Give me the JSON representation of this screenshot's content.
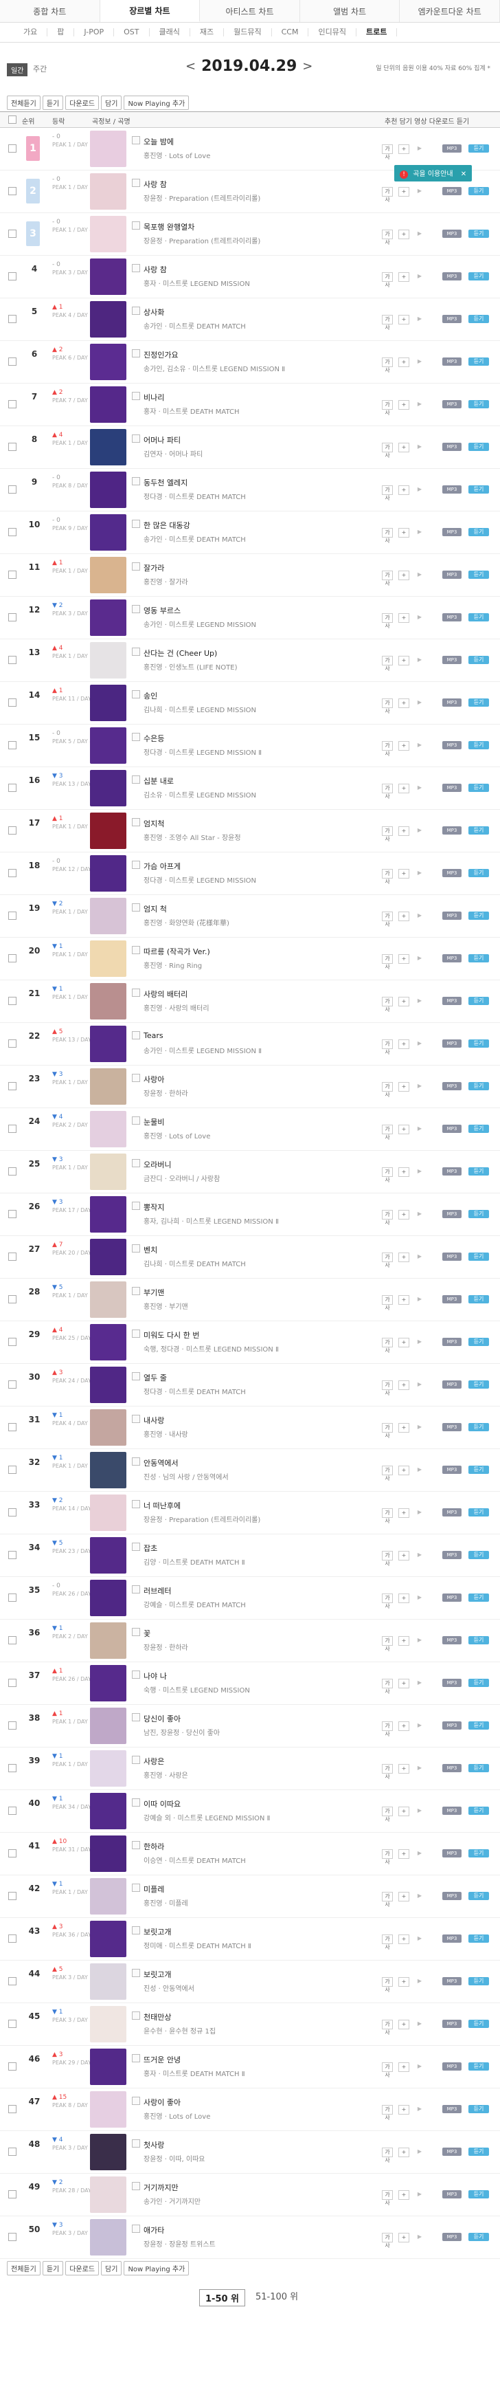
{
  "main_tabs": [
    "종합 차트",
    "장르별 차트",
    "아티스트 차트",
    "앨범 차트",
    "엠카운트다운 차트"
  ],
  "active_main_tab": 1,
  "sub_tabs": [
    "가요",
    "팝",
    "J-POP",
    "OST",
    "클래식",
    "재즈",
    "월드뮤직",
    "CCM",
    "인디뮤직",
    "트로트"
  ],
  "active_sub_tab": 9,
  "period": {
    "mode_badge": "일간",
    "mode_text": "주간",
    "date": "2019.04.29",
    "prev": "<",
    "next": ">",
    "note": "일 단위의 음원 이용 40% 자료 60% 집계 *"
  },
  "toolbar": [
    "전체듣기",
    "듣기",
    "다운로드",
    "담기",
    "Now Playing 추가"
  ],
  "header": {
    "rank": "순위",
    "change": "등락",
    "info": "곡정보 / 곡명",
    "cols": "추천 담기 영상 다운로드 듣기"
  },
  "tooltip": {
    "warn": "!",
    "text": "곡을 이용안내",
    "close": "✕"
  },
  "rows": [
    {
      "rank": "1",
      "chg": "- 0",
      "peak": "PEAK 1 / DAY 12",
      "title": "오늘 밤에",
      "artist": "홍진영 · Lots of Love",
      "cover": "#e8cde0",
      "dir": "same",
      "box": "first"
    },
    {
      "rank": "2",
      "chg": "- 0",
      "peak": "PEAK 1 / DAY 26",
      "title": "사랑 참",
      "artist": "장윤정 · Preparation (트레트라이리롤)",
      "cover": "#ead0d6",
      "dir": "same",
      "box": "blue"
    },
    {
      "rank": "3",
      "chg": "- 0",
      "peak": "PEAK 1 / DAY 46",
      "title": "목포행 완행열차",
      "artist": "장윤정 · Preparation (트레트라이리롤)",
      "cover": "#efd7df",
      "dir": "same",
      "box": "blue"
    },
    {
      "rank": "4",
      "chg": "- 0",
      "peak": "PEAK 3 / DAY 11",
      "title": "사랑 참",
      "artist": "홍자 · 미스트롯 LEGEND MISSION",
      "cover": "#5a2a8a",
      "dir": "same"
    },
    {
      "rank": "5",
      "chg": "▲ 1",
      "peak": "PEAK 4 / DAY 31",
      "title": "상사화",
      "artist": "송가인 · 미스트롯 DEATH MATCH",
      "cover": "#4e2680",
      "dir": "up"
    },
    {
      "rank": "6",
      "chg": "▲ 2",
      "peak": "PEAK 6 / DAY 3",
      "title": "진정인가요",
      "artist": "송가인, 김소유 · 미스트롯 LEGEND MISSION Ⅱ",
      "cover": "#5b2c91",
      "dir": "up"
    },
    {
      "rank": "7",
      "chg": "▲ 2",
      "peak": "PEAK 7 / DAY 31",
      "title": "비나리",
      "artist": "홍자 · 미스트롯 DEATH MATCH",
      "cover": "#55288a",
      "dir": "up"
    },
    {
      "rank": "8",
      "chg": "▲ 4",
      "peak": "PEAK 1 / DAY 802",
      "title": "어머나 파티",
      "artist": "김연자 · 어머나 파티",
      "cover": "#2a3f7a",
      "dir": "up"
    },
    {
      "rank": "9",
      "chg": "- 0",
      "peak": "PEAK 8 / DAY 31",
      "title": "동두천 엘레지",
      "artist": "정다경 · 미스트롯 DEATH MATCH",
      "cover": "#4f2585",
      "dir": "same"
    },
    {
      "rank": "10",
      "chg": "- 0",
      "peak": "PEAK 9 / DAY 20",
      "title": "한 많은 대동강",
      "artist": "송가인 · 미스트롯 DEATH MATCH",
      "cover": "#532a8c",
      "dir": "same"
    },
    {
      "rank": "11",
      "chg": "▲ 1",
      "peak": "PEAK 1 / DAY 443",
      "title": "잘가라",
      "artist": "홍진영 · 잘가라",
      "cover": "#d9b48f",
      "dir": "up"
    },
    {
      "rank": "12",
      "chg": "▼ 2",
      "peak": "PEAK 3 / DAY 6",
      "title": "영동 부르스",
      "artist": "송가인 · 미스트롯 LEGEND MISSION",
      "cover": "#5a2b8e",
      "dir": "down"
    },
    {
      "rank": "13",
      "chg": "▲ 4",
      "peak": "PEAK 1 / DAY 1026",
      "title": "산다는 건 (Cheer Up)",
      "artist": "홍진영 · 인생노트 (LIFE NOTE)",
      "cover": "#e6e3e5",
      "dir": "up"
    },
    {
      "rank": "14",
      "chg": "▲ 1",
      "peak": "PEAK 11 / DAY 11",
      "title": "송인",
      "artist": "김나희 · 미스트롯 LEGEND MISSION",
      "cover": "#4b2682",
      "dir": "up"
    },
    {
      "rank": "15",
      "chg": "- 0",
      "peak": "PEAK 5 / DAY 4",
      "title": "수은등",
      "artist": "정다경 · 미스트롯 LEGEND MISSION Ⅱ",
      "cover": "#562b8d",
      "dir": "same"
    },
    {
      "rank": "16",
      "chg": "▼ 3",
      "peak": "PEAK 13 / DAY 11",
      "title": "십분 내로",
      "artist": "김소유 · 미스트롯 LEGEND MISSION",
      "cover": "#4e2785",
      "dir": "down"
    },
    {
      "rank": "17",
      "chg": "▲ 1",
      "peak": "PEAK 1 / DAY 1577",
      "title": "엄지척",
      "artist": "홍진영 · 조영수 All Star - 장윤정",
      "cover": "#8a1a2a",
      "dir": "up"
    },
    {
      "rank": "18",
      "chg": "- 0",
      "peak": "PEAK 12 / DAY 11",
      "title": "가슴 아프게",
      "artist": "정다경 · 미스트롯 LEGEND MISSION",
      "cover": "#512888",
      "dir": "same"
    },
    {
      "rank": "19",
      "chg": "▼ 2",
      "peak": "PEAK 1 / DAY 1122",
      "title": "엄지 척",
      "artist": "홍진영 · 화양연화 (花樣年華)",
      "cover": "#d7c3d6",
      "dir": "down"
    },
    {
      "rank": "20",
      "chg": "▼ 1",
      "peak": "PEAK 1 / DAY 740",
      "title": "따르릉 (작곡가 Ver.)",
      "artist": "홍진영 · Ring Ring",
      "cover": "#f0d9b0",
      "dir": "down"
    },
    {
      "rank": "21",
      "chg": "▼ 1",
      "peak": "PEAK 1 / DAY 2799",
      "title": "사랑의 배터리",
      "artist": "홍진영 · 사랑의 배터리",
      "cover": "#b98f8f",
      "dir": "down"
    },
    {
      "rank": "22",
      "chg": "▲ 5",
      "peak": "PEAK 13 / DAY 4",
      "title": "Tears",
      "artist": "송가인 · 미스트롯 LEGEND MISSION Ⅱ",
      "cover": "#552a8b",
      "dir": "up"
    },
    {
      "rank": "23",
      "chg": "▼ 3",
      "peak": "PEAK 1 / DAY 2749",
      "title": "사랑아",
      "artist": "장윤정 · 한하라",
      "cover": "#c9b29e",
      "dir": "down"
    },
    {
      "rank": "24",
      "chg": "▼ 4",
      "peak": "PEAK 2 / DAY 32",
      "title": "눈물비",
      "artist": "홍진영 · Lots of Love",
      "cover": "#e4cfe0",
      "dir": "down"
    },
    {
      "rank": "25",
      "chg": "▼ 3",
      "peak": "PEAK 1 / DAY 2169",
      "title": "오라버니",
      "artist": "금잔디 · 오라버니 / 사랑참",
      "cover": "#e8dcc8",
      "dir": "down"
    },
    {
      "rank": "26",
      "chg": "▼ 3",
      "peak": "PEAK 17 / DAY 4",
      "title": "뽕작지",
      "artist": "홍자, 김나희 · 미스트롯 LEGEND MISSION Ⅱ",
      "cover": "#56298c",
      "dir": "down"
    },
    {
      "rank": "27",
      "chg": "▲ 7",
      "peak": "PEAK 20 / DAY 31",
      "title": "벤치",
      "artist": "김나희 · 미스트롯 DEATH MATCH",
      "cover": "#4d2683",
      "dir": "up"
    },
    {
      "rank": "28",
      "chg": "▼ 5",
      "peak": "PEAK 1 / DAY 2229",
      "title": "부기맨",
      "artist": "홍진영 · 부기맨",
      "cover": "#d8c6c0",
      "dir": "down"
    },
    {
      "rank": "29",
      "chg": "▲ 4",
      "peak": "PEAK 25 / DAY 3",
      "title": "미워도 다시 한 번",
      "artist": "숙행, 정다경 · 미스트롯 LEGEND MISSION Ⅱ",
      "cover": "#582b8f",
      "dir": "up"
    },
    {
      "rank": "30",
      "chg": "▲ 3",
      "peak": "PEAK 24 / DAY 30",
      "title": "열두 줄",
      "artist": "정다경 · 미스트롯 DEATH MATCH",
      "cover": "#502786",
      "dir": "up"
    },
    {
      "rank": "31",
      "chg": "▼ 1",
      "peak": "PEAK 4 / DAY 2744",
      "title": "내사랑",
      "artist": "홍진영 · 내사랑",
      "cover": "#c4a6a0",
      "dir": "down"
    },
    {
      "rank": "32",
      "chg": "▼ 1",
      "peak": "PEAK 1 / DAY 2868",
      "title": "안동역에서",
      "artist": "진성 · 님의 사랑 / 안동역에서",
      "cover": "#3a4a6a",
      "dir": "down"
    },
    {
      "rank": "33",
      "chg": "▼ 2",
      "peak": "PEAK 14 / DAY 17",
      "title": "너 떠난후에",
      "artist": "장윤정 · Preparation (트레트라이리롤)",
      "cover": "#e9d0d8",
      "dir": "down"
    },
    {
      "rank": "34",
      "chg": "▼ 5",
      "peak": "PEAK 23 / DAY 31",
      "title": "잡초",
      "artist": "김양 · 미스트롯 DEATH MATCH Ⅱ",
      "cover": "#542989",
      "dir": "down"
    },
    {
      "rank": "35",
      "chg": "- 0",
      "peak": "PEAK 26 / DAY 31",
      "title": "러브레터",
      "artist": "강예슬 · 미스트롯 DEATH MATCH",
      "cover": "#4f2785",
      "dir": "same"
    },
    {
      "rank": "36",
      "chg": "▼ 1",
      "peak": "PEAK 2 / DAY 2768",
      "title": "꽃",
      "artist": "장윤정 · 한하라",
      "cover": "#cbb3a1",
      "dir": "down"
    },
    {
      "rank": "37",
      "chg": "▲ 1",
      "peak": "PEAK 26 / DAY 6",
      "title": "나야 나",
      "artist": "숙행 · 미스트롯 LEGEND MISSION",
      "cover": "#562a8c",
      "dir": "up"
    },
    {
      "rank": "38",
      "chg": "▲ 1",
      "peak": "PEAK 1 / DAY 1785",
      "title": "당신이 좋아",
      "artist": "남진, 장윤정 · 당신이 좋아",
      "cover": "#bfa8c8",
      "dir": "up"
    },
    {
      "rank": "39",
      "chg": "▼ 1",
      "peak": "PEAK 1 / DAY 1929",
      "title": "사랑은",
      "artist": "홍진영 · 사랑은",
      "cover": "#e3d7e8",
      "dir": "down"
    },
    {
      "rank": "40",
      "chg": "▼ 1",
      "peak": "PEAK 34 / DAY 6",
      "title": "이따 이따요",
      "artist": "강예슬 외 · 미스트롯 LEGEND MISSION Ⅱ",
      "cover": "#532a8b",
      "dir": "down"
    },
    {
      "rank": "41",
      "chg": "▲ 10",
      "peak": "PEAK 31 / DAY 30",
      "title": "한하라",
      "artist": "이승연 · 미스트롯 DEATH MATCH",
      "cover": "#4c2581",
      "dir": "up"
    },
    {
      "rank": "42",
      "chg": "▼ 1",
      "peak": "PEAK 1 / DAY 1901",
      "title": "미플레",
      "artist": "홍진영 · 미플레",
      "cover": "#d2c2d8",
      "dir": "down"
    },
    {
      "rank": "43",
      "chg": "▲ 3",
      "peak": "PEAK 36 / DAY 30",
      "title": "보릿고개",
      "artist": "정미애 · 미스트롯 DEATH MATCH Ⅱ",
      "cover": "#552a8b",
      "dir": "up"
    },
    {
      "rank": "44",
      "chg": "▲ 5",
      "peak": "PEAK 3 / DAY 1126",
      "title": "보릿고개",
      "artist": "진성 · 안동역에서",
      "cover": "#dcd6e0",
      "dir": "up"
    },
    {
      "rank": "45",
      "chg": "▼ 1",
      "peak": "PEAK 3 / DAY 271",
      "title": "천태만상",
      "artist": "윤수현 · 윤수현 정규 1집",
      "cover": "#f0e6e2",
      "dir": "down"
    },
    {
      "rank": "46",
      "chg": "▲ 3",
      "peak": "PEAK 29 / DAY 32",
      "title": "뜨거운 안녕",
      "artist": "홍자 · 미스트롯 DEATH MATCH Ⅱ",
      "cover": "#532989",
      "dir": "up"
    },
    {
      "rank": "47",
      "chg": "▲ 15",
      "peak": "PEAK 8 / DAY 32",
      "title": "사랑이 좋아",
      "artist": "홍진영 · Lots of Love",
      "cover": "#e6cfe2",
      "dir": "up"
    },
    {
      "rank": "48",
      "chg": "▼ 4",
      "peak": "PEAK 3 / DAY 2750",
      "title": "첫사랑",
      "artist": "장윤정 · 이따, 이따요",
      "cover": "#3a2e4a",
      "dir": "down"
    },
    {
      "rank": "49",
      "chg": "▼ 2",
      "peak": "PEAK 28 / DAY 15",
      "title": "거기까지만",
      "artist": "송가인 · 거기까지만",
      "cover": "#e9d9de",
      "dir": "down"
    },
    {
      "rank": "50",
      "chg": "▼ 3",
      "peak": "PEAK 3 / DAY 2791",
      "title": "애가타",
      "artist": "장윤정 · 장윤정 트위스트",
      "cover": "#c8bfd8",
      "dir": "down"
    }
  ],
  "pager": [
    "1-50 위",
    "51-100 위"
  ],
  "row_buttons": {
    "mv": "가사",
    "add": "+",
    "video": "▶",
    "mp3": "MP3",
    "listen": "듣기"
  },
  "colors": {
    "accent_up": "#e44444",
    "accent_down": "#3a7bd5",
    "listen_btn": "#4fb3df",
    "tooltip": "#2aa0ac"
  }
}
